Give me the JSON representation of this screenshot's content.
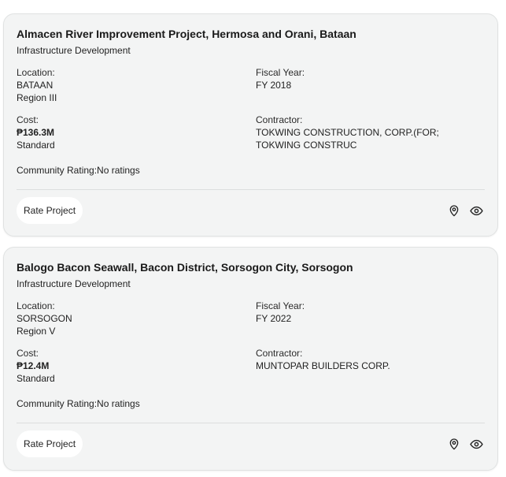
{
  "projects": [
    {
      "title": "Almacen River Improvement Project, Hermosa and Orani, Bataan",
      "category": "Infrastructure Development",
      "location_label": "Location:",
      "province": "BATAAN",
      "region": "Region III",
      "fiscal_year_label": "Fiscal Year:",
      "fiscal_year": "FY 2018",
      "cost_label": "Cost:",
      "cost": "₱136.3M",
      "cost_type": "Standard",
      "contractor_label": "Contractor:",
      "contractor": "TOKWING CONSTRUCTION, CORP.(FOR; TOKWING CONSTRUC",
      "rating_text": "Community Rating:No ratings",
      "rate_button": "Rate Project",
      "icons": [
        "map-pin-icon",
        "eye-icon"
      ]
    },
    {
      "title": "Balogo Bacon Seawall, Bacon District, Sorsogon City, Sorsogon",
      "category": "Infrastructure Development",
      "location_label": "Location:",
      "province": "SORSOGON",
      "region": "Region V",
      "fiscal_year_label": "Fiscal Year:",
      "fiscal_year": "FY 2022",
      "cost_label": "Cost:",
      "cost": "₱12.4M",
      "cost_type": "Standard",
      "contractor_label": "Contractor:",
      "contractor": "MUNTOPAR BUILDERS CORP.",
      "rating_text": "Community Rating:No ratings",
      "rate_button": "Rate Project",
      "icons": [
        "map-pin-icon",
        "eye-icon"
      ]
    }
  ]
}
